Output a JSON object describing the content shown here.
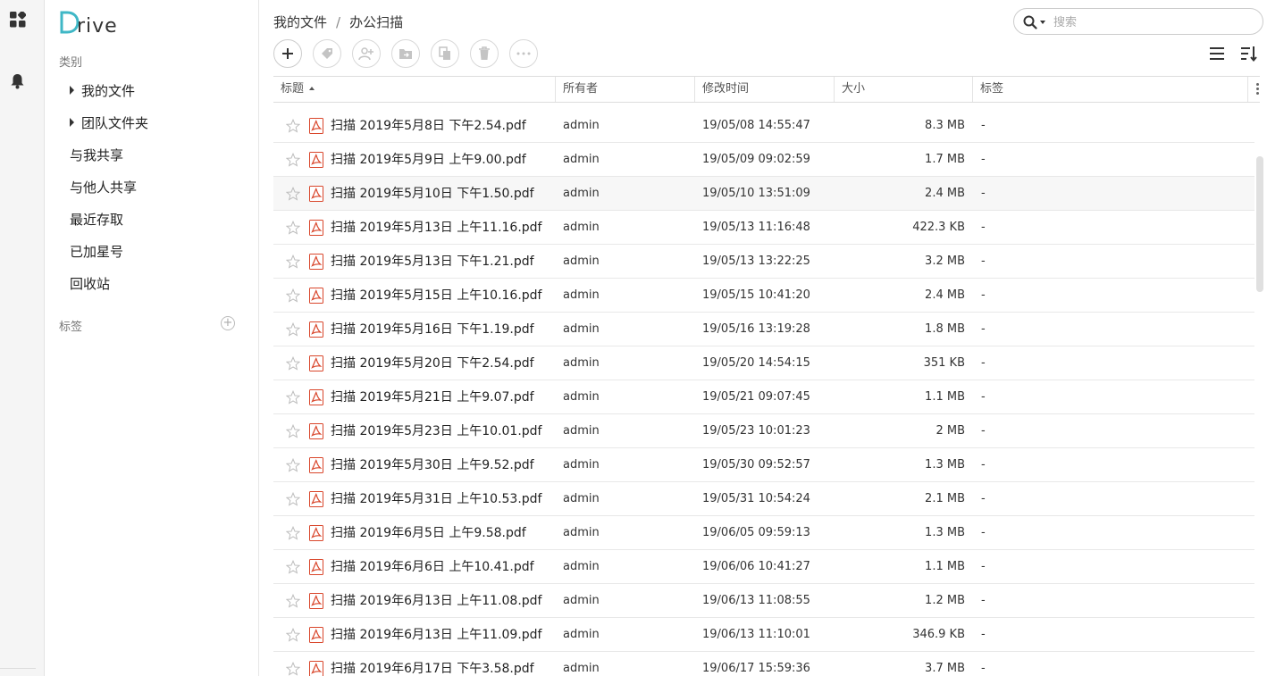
{
  "sidebar": {
    "logo_text": "Drive",
    "category_label": "类别",
    "items": [
      {
        "label": "我的文件",
        "caret": true
      },
      {
        "label": "团队文件夹",
        "caret": true
      },
      {
        "label": "与我共享",
        "caret": false
      },
      {
        "label": "与他人共享",
        "caret": false
      },
      {
        "label": "最近存取",
        "caret": false
      },
      {
        "label": "已加星号",
        "caret": false
      },
      {
        "label": "回收站",
        "caret": false
      }
    ],
    "tags_label": "标签",
    "tags_add_glyph": "+"
  },
  "breadcrumb": {
    "root": "我的文件",
    "separator": "/",
    "current": "办公扫描"
  },
  "search": {
    "placeholder": "搜索",
    "value": ""
  },
  "toolbar": {
    "buttons": [
      "add-icon",
      "tag-icon",
      "share-user-icon",
      "move-folder-icon",
      "copy-icon",
      "delete-icon",
      "more-icon"
    ]
  },
  "table": {
    "columns": {
      "title": "标题",
      "owner": "所有者",
      "mtime": "修改时间",
      "size": "大小",
      "tags": "标签"
    },
    "rows": [
      {
        "name": "扫描 2019年5月8日 下午2.54.pdf",
        "owner": "admin",
        "mtime": "19/05/08 14:55:47",
        "size": "8.3 MB",
        "tags": "-"
      },
      {
        "name": "扫描 2019年5月9日 上午9.00.pdf",
        "owner": "admin",
        "mtime": "19/05/09 09:02:59",
        "size": "1.7 MB",
        "tags": "-"
      },
      {
        "name": "扫描 2019年5月10日 下午1.50.pdf",
        "owner": "admin",
        "mtime": "19/05/10 13:51:09",
        "size": "2.4 MB",
        "tags": "-"
      },
      {
        "name": "扫描 2019年5月13日 上午11.16.pdf",
        "owner": "admin",
        "mtime": "19/05/13 11:16:48",
        "size": "422.3 KB",
        "tags": "-"
      },
      {
        "name": "扫描 2019年5月13日 下午1.21.pdf",
        "owner": "admin",
        "mtime": "19/05/13 13:22:25",
        "size": "3.2 MB",
        "tags": "-"
      },
      {
        "name": "扫描 2019年5月15日 上午10.16.pdf",
        "owner": "admin",
        "mtime": "19/05/15 10:41:20",
        "size": "2.4 MB",
        "tags": "-"
      },
      {
        "name": "扫描 2019年5月16日 下午1.19.pdf",
        "owner": "admin",
        "mtime": "19/05/16 13:19:28",
        "size": "1.8 MB",
        "tags": "-"
      },
      {
        "name": "扫描 2019年5月20日 下午2.54.pdf",
        "owner": "admin",
        "mtime": "19/05/20 14:54:15",
        "size": "351 KB",
        "tags": "-"
      },
      {
        "name": "扫描 2019年5月21日 上午9.07.pdf",
        "owner": "admin",
        "mtime": "19/05/21 09:07:45",
        "size": "1.1 MB",
        "tags": "-"
      },
      {
        "name": "扫描 2019年5月23日 上午10.01.pdf",
        "owner": "admin",
        "mtime": "19/05/23 10:01:23",
        "size": "2 MB",
        "tags": "-"
      },
      {
        "name": "扫描 2019年5月30日 上午9.52.pdf",
        "owner": "admin",
        "mtime": "19/05/30 09:52:57",
        "size": "1.3 MB",
        "tags": "-"
      },
      {
        "name": "扫描 2019年5月31日 上午10.53.pdf",
        "owner": "admin",
        "mtime": "19/05/31 10:54:24",
        "size": "2.1 MB",
        "tags": "-"
      },
      {
        "name": "扫描 2019年6月5日 上午9.58.pdf",
        "owner": "admin",
        "mtime": "19/06/05 09:59:13",
        "size": "1.3 MB",
        "tags": "-"
      },
      {
        "name": "扫描 2019年6月6日 上午10.41.pdf",
        "owner": "admin",
        "mtime": "19/06/06 10:41:27",
        "size": "1.1 MB",
        "tags": "-"
      },
      {
        "name": "扫描 2019年6月13日 上午11.08.pdf",
        "owner": "admin",
        "mtime": "19/06/13 11:08:55",
        "size": "1.2 MB",
        "tags": "-"
      },
      {
        "name": "扫描 2019年6月13日 上午11.09.pdf",
        "owner": "admin",
        "mtime": "19/06/13 11:10:01",
        "size": "346.9 KB",
        "tags": "-"
      },
      {
        "name": "扫描 2019年6月17日 下午3.58.pdf",
        "owner": "admin",
        "mtime": "19/06/17 15:59:36",
        "size": "3.7 MB",
        "tags": "-"
      }
    ]
  },
  "colors": {
    "logo_accent": "#3fb7c6",
    "pdf_red": "#d9462b",
    "border": "#dddddd",
    "row_highlight": "#f7f7f7"
  }
}
